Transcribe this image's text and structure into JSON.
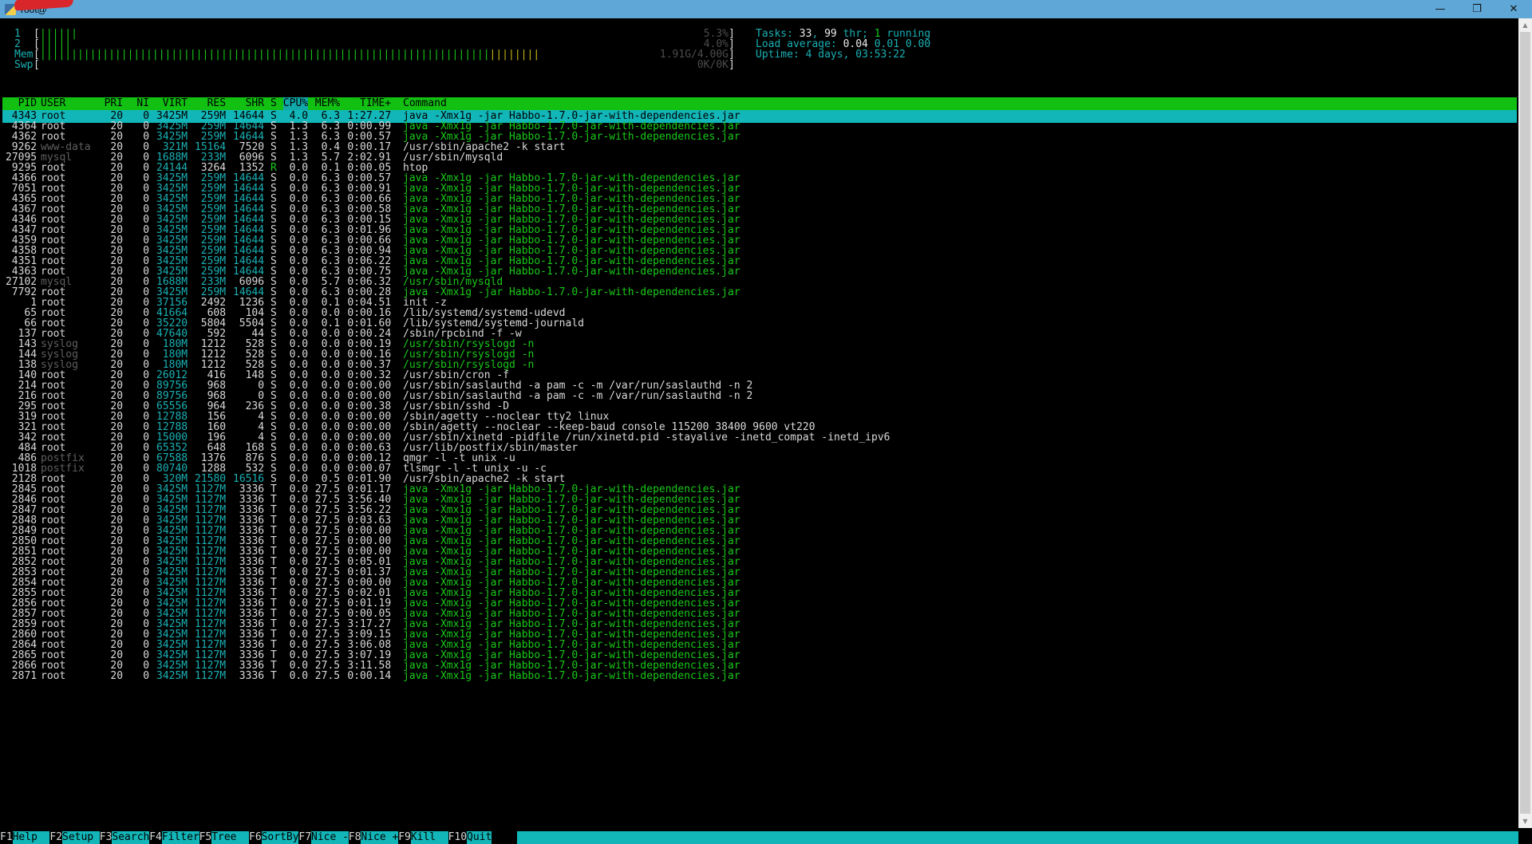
{
  "window": {
    "title": "root@",
    "minimize_icon": "minimize-icon",
    "restore_icon": "restore-icon",
    "close_icon": "close-icon",
    "minimize_glyph": "—",
    "restore_glyph": "❐",
    "close_glyph": "✕"
  },
  "meters": [
    {
      "label": "1",
      "bar": "||||||",
      "value": "5.3%",
      "level_percent": 5.3
    },
    {
      "label": "2",
      "bar": "|||||",
      "value": "4.0%",
      "level_percent": 4.0
    },
    {
      "label": "Mem",
      "bar": "||||||||||||||||||||||||||||||||||||||||||||||||||||||||||||||||||||||||||||||||",
      "value": "1.91G/4.00G",
      "level_percent": 47.75
    },
    {
      "label": "Swp",
      "bar": "",
      "value": "0K/0K",
      "level_percent": 0
    }
  ],
  "summary": {
    "tasks_label": "Tasks: ",
    "tasks": "33",
    "threads_sep": ", ",
    "threads": "99",
    "threads_label": " thr; ",
    "running": "1",
    "running_label": " running",
    "load_label": "Load average: ",
    "load1": "0.04",
    "load5": "0.01",
    "load15": "0.00",
    "uptime_label": "Uptime: ",
    "uptime": "4 days, 03:53:22"
  },
  "columns": [
    "PID",
    "USER",
    "PRI",
    "NI",
    "VIRT",
    "RES",
    "SHR",
    "S",
    "CPU%",
    "MEM%",
    "TIME+",
    "Command"
  ],
  "sort_column": "CPU%",
  "processes": [
    [
      "4343",
      "root",
      "20",
      "0",
      "3425M",
      "259M",
      "14644",
      "S",
      "4.0",
      "6.3",
      "1:27.27",
      "java -Xmx1g -jar Habbo-1.7.0-jar-with-dependencies.jar"
    ],
    [
      "4364",
      "root",
      "20",
      "0",
      "3425M",
      "259M",
      "14644",
      "S",
      "1.3",
      "6.3",
      "0:00.99",
      "java -Xmx1g -jar Habbo-1.7.0-jar-with-dependencies.jar"
    ],
    [
      "4362",
      "root",
      "20",
      "0",
      "3425M",
      "259M",
      "14644",
      "S",
      "1.3",
      "6.3",
      "0:00.57",
      "java -Xmx1g -jar Habbo-1.7.0-jar-with-dependencies.jar"
    ],
    [
      "9262",
      "www-data",
      "20",
      "0",
      "321M",
      "15164",
      "7520",
      "S",
      "1.3",
      "0.4",
      "0:00.17",
      "/usr/sbin/apache2 -k start"
    ],
    [
      "27095",
      "mysql",
      "20",
      "0",
      "1688M",
      "233M",
      "6096",
      "S",
      "1.3",
      "5.7",
      "2:02.91",
      "/usr/sbin/mysqld"
    ],
    [
      "9295",
      "root",
      "20",
      "0",
      "24144",
      "3264",
      "1352",
      "R",
      "0.0",
      "0.1",
      "0:00.05",
      "htop"
    ],
    [
      "4366",
      "root",
      "20",
      "0",
      "3425M",
      "259M",
      "14644",
      "S",
      "0.0",
      "6.3",
      "0:00.57",
      "java -Xmx1g -jar Habbo-1.7.0-jar-with-dependencies.jar"
    ],
    [
      "7051",
      "root",
      "20",
      "0",
      "3425M",
      "259M",
      "14644",
      "S",
      "0.0",
      "6.3",
      "0:00.91",
      "java -Xmx1g -jar Habbo-1.7.0-jar-with-dependencies.jar"
    ],
    [
      "4365",
      "root",
      "20",
      "0",
      "3425M",
      "259M",
      "14644",
      "S",
      "0.0",
      "6.3",
      "0:00.66",
      "java -Xmx1g -jar Habbo-1.7.0-jar-with-dependencies.jar"
    ],
    [
      "4367",
      "root",
      "20",
      "0",
      "3425M",
      "259M",
      "14644",
      "S",
      "0.0",
      "6.3",
      "0:00.58",
      "java -Xmx1g -jar Habbo-1.7.0-jar-with-dependencies.jar"
    ],
    [
      "4346",
      "root",
      "20",
      "0",
      "3425M",
      "259M",
      "14644",
      "S",
      "0.0",
      "6.3",
      "0:00.15",
      "java -Xmx1g -jar Habbo-1.7.0-jar-with-dependencies.jar"
    ],
    [
      "4347",
      "root",
      "20",
      "0",
      "3425M",
      "259M",
      "14644",
      "S",
      "0.0",
      "6.3",
      "0:01.96",
      "java -Xmx1g -jar Habbo-1.7.0-jar-with-dependencies.jar"
    ],
    [
      "4359",
      "root",
      "20",
      "0",
      "3425M",
      "259M",
      "14644",
      "S",
      "0.0",
      "6.3",
      "0:00.66",
      "java -Xmx1g -jar Habbo-1.7.0-jar-with-dependencies.jar"
    ],
    [
      "4358",
      "root",
      "20",
      "0",
      "3425M",
      "259M",
      "14644",
      "S",
      "0.0",
      "6.3",
      "0:00.94",
      "java -Xmx1g -jar Habbo-1.7.0-jar-with-dependencies.jar"
    ],
    [
      "4351",
      "root",
      "20",
      "0",
      "3425M",
      "259M",
      "14644",
      "S",
      "0.0",
      "6.3",
      "0:06.22",
      "java -Xmx1g -jar Habbo-1.7.0-jar-with-dependencies.jar"
    ],
    [
      "4363",
      "root",
      "20",
      "0",
      "3425M",
      "259M",
      "14644",
      "S",
      "0.0",
      "6.3",
      "0:00.75",
      "java -Xmx1g -jar Habbo-1.7.0-jar-with-dependencies.jar"
    ],
    [
      "27102",
      "mysql",
      "20",
      "0",
      "1688M",
      "233M",
      "6096",
      "S",
      "0.0",
      "5.7",
      "0:06.32",
      "/usr/sbin/mysqld"
    ],
    [
      "7792",
      "root",
      "20",
      "0",
      "3425M",
      "259M",
      "14644",
      "S",
      "0.0",
      "6.3",
      "0:00.28",
      "java -Xmx1g -jar Habbo-1.7.0-jar-with-dependencies.jar"
    ],
    [
      "1",
      "root",
      "20",
      "0",
      "37156",
      "2492",
      "1236",
      "S",
      "0.0",
      "0.1",
      "0:04.51",
      "init -z"
    ],
    [
      "65",
      "root",
      "20",
      "0",
      "41664",
      "608",
      "104",
      "S",
      "0.0",
      "0.0",
      "0:00.16",
      "/lib/systemd/systemd-udevd"
    ],
    [
      "66",
      "root",
      "20",
      "0",
      "35220",
      "5804",
      "5504",
      "S",
      "0.0",
      "0.1",
      "0:01.60",
      "/lib/systemd/systemd-journald"
    ],
    [
      "137",
      "root",
      "20",
      "0",
      "47640",
      "592",
      "44",
      "S",
      "0.0",
      "0.0",
      "0:00.24",
      "/sbin/rpcbind -f -w"
    ],
    [
      "143",
      "syslog",
      "20",
      "0",
      "180M",
      "1212",
      "528",
      "S",
      "0.0",
      "0.0",
      "0:00.19",
      "/usr/sbin/rsyslogd -n"
    ],
    [
      "144",
      "syslog",
      "20",
      "0",
      "180M",
      "1212",
      "528",
      "S",
      "0.0",
      "0.0",
      "0:00.16",
      "/usr/sbin/rsyslogd -n"
    ],
    [
      "138",
      "syslog",
      "20",
      "0",
      "180M",
      "1212",
      "528",
      "S",
      "0.0",
      "0.0",
      "0:00.37",
      "/usr/sbin/rsyslogd -n"
    ],
    [
      "140",
      "root",
      "20",
      "0",
      "26012",
      "416",
      "148",
      "S",
      "0.0",
      "0.0",
      "0:00.32",
      "/usr/sbin/cron -f"
    ],
    [
      "214",
      "root",
      "20",
      "0",
      "89756",
      "968",
      "0",
      "S",
      "0.0",
      "0.0",
      "0:00.00",
      "/usr/sbin/saslauthd -a pam -c -m /var/run/saslauthd -n 2"
    ],
    [
      "216",
      "root",
      "20",
      "0",
      "89756",
      "968",
      "0",
      "S",
      "0.0",
      "0.0",
      "0:00.00",
      "/usr/sbin/saslauthd -a pam -c -m /var/run/saslauthd -n 2"
    ],
    [
      "295",
      "root",
      "20",
      "0",
      "65556",
      "964",
      "236",
      "S",
      "0.0",
      "0.0",
      "0:00.38",
      "/usr/sbin/sshd -D"
    ],
    [
      "319",
      "root",
      "20",
      "0",
      "12788",
      "156",
      "4",
      "S",
      "0.0",
      "0.0",
      "0:00.00",
      "/sbin/agetty --noclear tty2 linux"
    ],
    [
      "321",
      "root",
      "20",
      "0",
      "12788",
      "160",
      "4",
      "S",
      "0.0",
      "0.0",
      "0:00.00",
      "/sbin/agetty --noclear --keep-baud console 115200 38400 9600 vt220"
    ],
    [
      "342",
      "root",
      "20",
      "0",
      "15000",
      "196",
      "4",
      "S",
      "0.0",
      "0.0",
      "0:00.00",
      "/usr/sbin/xinetd -pidfile /run/xinetd.pid -stayalive -inetd_compat -inetd_ipv6"
    ],
    [
      "484",
      "root",
      "20",
      "0",
      "65352",
      "648",
      "168",
      "S",
      "0.0",
      "0.0",
      "0:00.63",
      "/usr/lib/postfix/sbin/master"
    ],
    [
      "486",
      "postfix",
      "20",
      "0",
      "67588",
      "1376",
      "876",
      "S",
      "0.0",
      "0.0",
      "0:00.12",
      "qmgr -l -t unix -u"
    ],
    [
      "1018",
      "postfix",
      "20",
      "0",
      "80740",
      "1288",
      "532",
      "S",
      "0.0",
      "0.0",
      "0:00.07",
      "tlsmgr -l -t unix -u -c"
    ],
    [
      "2128",
      "root",
      "20",
      "0",
      "320M",
      "21580",
      "16516",
      "S",
      "0.0",
      "0.5",
      "0:01.90",
      "/usr/sbin/apache2 -k start"
    ],
    [
      "2845",
      "root",
      "20",
      "0",
      "3425M",
      "1127M",
      "3336",
      "T",
      "0.0",
      "27.5",
      "0:01.17",
      "java -Xmx1g -jar Habbo-1.7.0-jar-with-dependencies.jar"
    ],
    [
      "2846",
      "root",
      "20",
      "0",
      "3425M",
      "1127M",
      "3336",
      "T",
      "0.0",
      "27.5",
      "3:56.40",
      "java -Xmx1g -jar Habbo-1.7.0-jar-with-dependencies.jar"
    ],
    [
      "2847",
      "root",
      "20",
      "0",
      "3425M",
      "1127M",
      "3336",
      "T",
      "0.0",
      "27.5",
      "3:56.22",
      "java -Xmx1g -jar Habbo-1.7.0-jar-with-dependencies.jar"
    ],
    [
      "2848",
      "root",
      "20",
      "0",
      "3425M",
      "1127M",
      "3336",
      "T",
      "0.0",
      "27.5",
      "0:03.63",
      "java -Xmx1g -jar Habbo-1.7.0-jar-with-dependencies.jar"
    ],
    [
      "2849",
      "root",
      "20",
      "0",
      "3425M",
      "1127M",
      "3336",
      "T",
      "0.0",
      "27.5",
      "0:00.00",
      "java -Xmx1g -jar Habbo-1.7.0-jar-with-dependencies.jar"
    ],
    [
      "2850",
      "root",
      "20",
      "0",
      "3425M",
      "1127M",
      "3336",
      "T",
      "0.0",
      "27.5",
      "0:00.00",
      "java -Xmx1g -jar Habbo-1.7.0-jar-with-dependencies.jar"
    ],
    [
      "2851",
      "root",
      "20",
      "0",
      "3425M",
      "1127M",
      "3336",
      "T",
      "0.0",
      "27.5",
      "0:00.00",
      "java -Xmx1g -jar Habbo-1.7.0-jar-with-dependencies.jar"
    ],
    [
      "2852",
      "root",
      "20",
      "0",
      "3425M",
      "1127M",
      "3336",
      "T",
      "0.0",
      "27.5",
      "0:05.01",
      "java -Xmx1g -jar Habbo-1.7.0-jar-with-dependencies.jar"
    ],
    [
      "2853",
      "root",
      "20",
      "0",
      "3425M",
      "1127M",
      "3336",
      "T",
      "0.0",
      "27.5",
      "0:01.37",
      "java -Xmx1g -jar Habbo-1.7.0-jar-with-dependencies.jar"
    ],
    [
      "2854",
      "root",
      "20",
      "0",
      "3425M",
      "1127M",
      "3336",
      "T",
      "0.0",
      "27.5",
      "0:00.00",
      "java -Xmx1g -jar Habbo-1.7.0-jar-with-dependencies.jar"
    ],
    [
      "2855",
      "root",
      "20",
      "0",
      "3425M",
      "1127M",
      "3336",
      "T",
      "0.0",
      "27.5",
      "0:02.01",
      "java -Xmx1g -jar Habbo-1.7.0-jar-with-dependencies.jar"
    ],
    [
      "2856",
      "root",
      "20",
      "0",
      "3425M",
      "1127M",
      "3336",
      "T",
      "0.0",
      "27.5",
      "0:01.19",
      "java -Xmx1g -jar Habbo-1.7.0-jar-with-dependencies.jar"
    ],
    [
      "2857",
      "root",
      "20",
      "0",
      "3425M",
      "1127M",
      "3336",
      "T",
      "0.0",
      "27.5",
      "0:00.05",
      "java -Xmx1g -jar Habbo-1.7.0-jar-with-dependencies.jar"
    ],
    [
      "2859",
      "root",
      "20",
      "0",
      "3425M",
      "1127M",
      "3336",
      "T",
      "0.0",
      "27.5",
      "3:17.27",
      "java -Xmx1g -jar Habbo-1.7.0-jar-with-dependencies.jar"
    ],
    [
      "2860",
      "root",
      "20",
      "0",
      "3425M",
      "1127M",
      "3336",
      "T",
      "0.0",
      "27.5",
      "3:09.15",
      "java -Xmx1g -jar Habbo-1.7.0-jar-with-dependencies.jar"
    ],
    [
      "2864",
      "root",
      "20",
      "0",
      "3425M",
      "1127M",
      "3336",
      "T",
      "0.0",
      "27.5",
      "3:06.08",
      "java -Xmx1g -jar Habbo-1.7.0-jar-with-dependencies.jar"
    ],
    [
      "2865",
      "root",
      "20",
      "0",
      "3425M",
      "1127M",
      "3336",
      "T",
      "0.0",
      "27.5",
      "3:07.19",
      "java -Xmx1g -jar Habbo-1.7.0-jar-with-dependencies.jar"
    ],
    [
      "2866",
      "root",
      "20",
      "0",
      "3425M",
      "1127M",
      "3336",
      "T",
      "0.0",
      "27.5",
      "3:11.58",
      "java -Xmx1g -jar Habbo-1.7.0-jar-with-dependencies.jar"
    ],
    [
      "2871",
      "root",
      "20",
      "0",
      "3425M",
      "1127M",
      "3336",
      "T",
      "0.0",
      "27.5",
      "0:00.14",
      "java -Xmx1g -jar Habbo-1.7.0-jar-with-dependencies.jar"
    ]
  ],
  "footer": [
    {
      "key": "F1",
      "label": "Help  "
    },
    {
      "key": "F2",
      "label": "Setup "
    },
    {
      "key": "F3",
      "label": "Search"
    },
    {
      "key": "F4",
      "label": "Filter"
    },
    {
      "key": "F5",
      "label": "Tree  "
    },
    {
      "key": "F6",
      "label": "SortBy"
    },
    {
      "key": "F7",
      "label": "Nice -"
    },
    {
      "key": "F8",
      "label": "Nice +"
    },
    {
      "key": "F9",
      "label": "Kill  "
    },
    {
      "key": "F10",
      "label": "Quit"
    }
  ],
  "colors": {
    "terminal_bg": "#000000",
    "green": "#19c919",
    "cyan": "#1ab0b4",
    "header_bg": "#12c012",
    "selected_bg": "#13b6b8",
    "titlebar_bg": "#5ea7d6"
  }
}
